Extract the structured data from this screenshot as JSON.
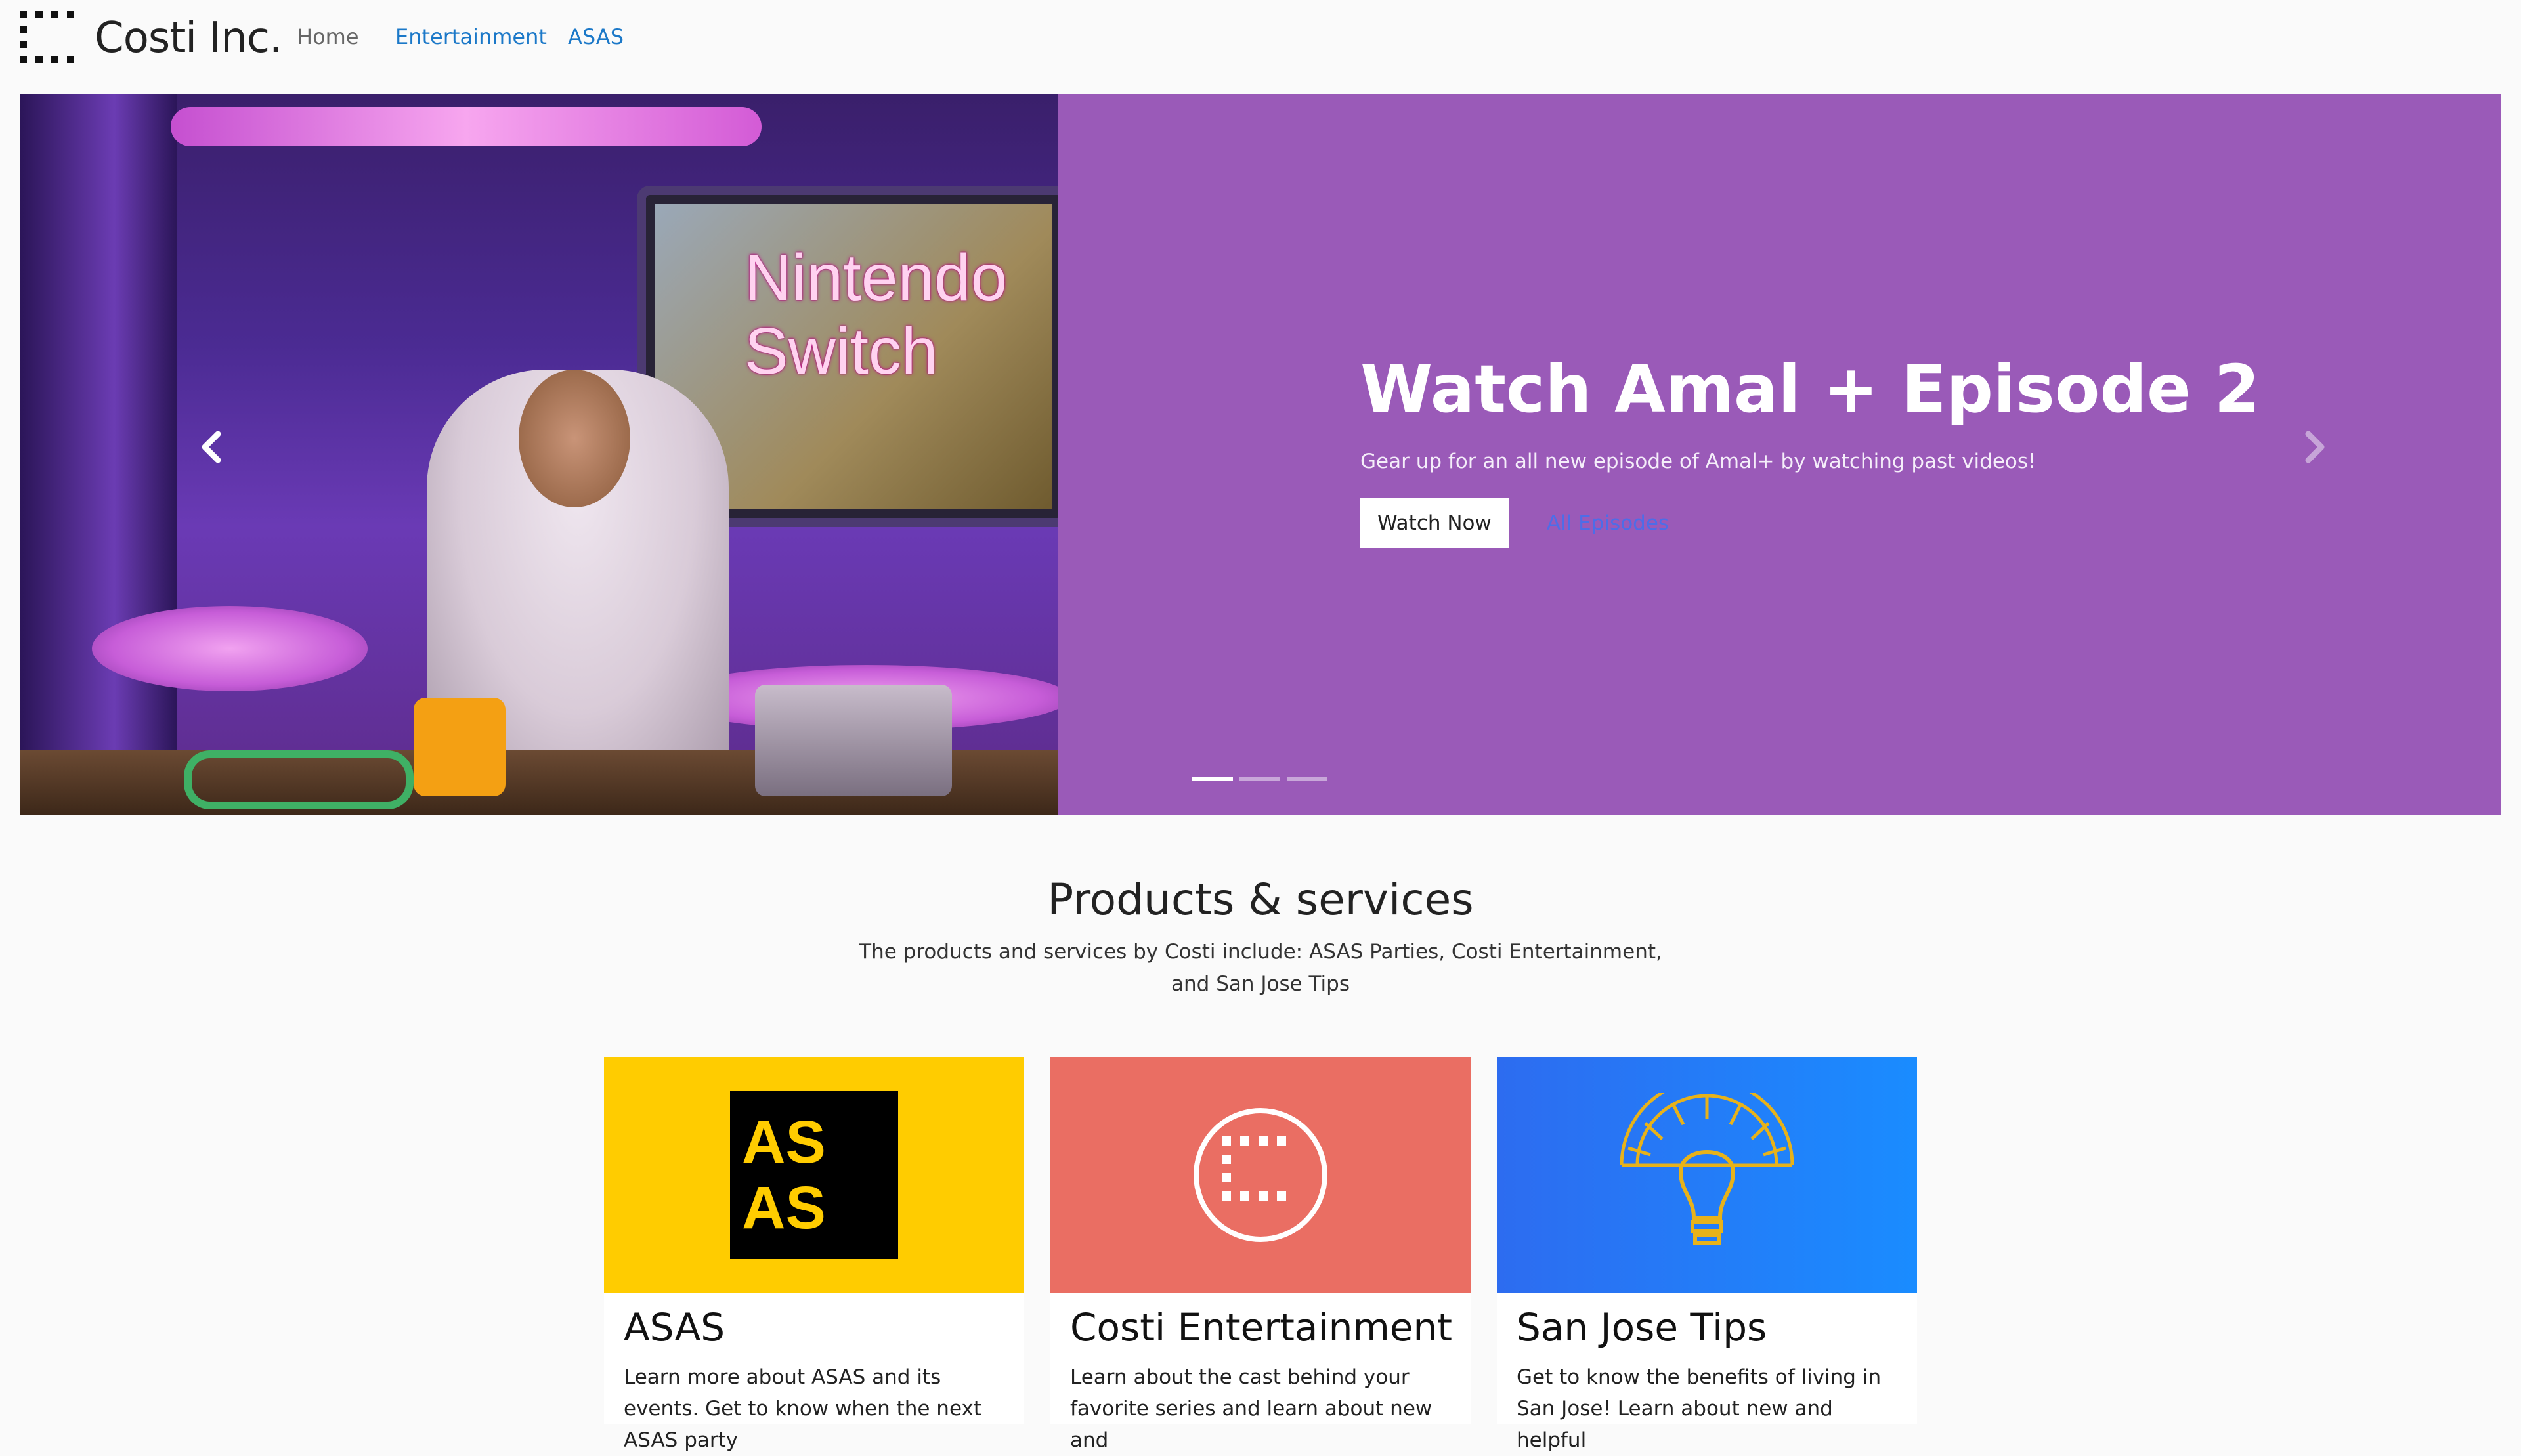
{
  "nav": {
    "brand": "Costi Inc.",
    "links": [
      "Home",
      "Entertainment",
      "ASAS"
    ]
  },
  "hero": {
    "image_text_line1": "Nintendo",
    "image_text_line2": "Switch",
    "title": "Watch Amal + Episode 2",
    "subtitle": "Gear up for an all new episode of Amal+ by watching past videos!",
    "primary_button": "Watch Now",
    "secondary_link": "All Episodes",
    "prev_icon": "chevron-left-icon",
    "next_icon": "chevron-right-icon",
    "slide_count": 3,
    "active_slide": 1,
    "background_color": "#9a5ab8"
  },
  "products": {
    "title": "Products & services",
    "description": "The products and services by Costi include: ASAS Parties, Costi Entertainment, and San Jose Tips",
    "cards": [
      {
        "title": "ASAS",
        "text": "Learn more about ASAS and its events. Get to know when the next ASAS party",
        "logo_line1": "AS",
        "logo_line2": "AS",
        "color": "#ffcc00"
      },
      {
        "title": "Costi Entertainment",
        "text": "Learn about the cast behind your favorite series and learn about new and",
        "icon": "film-frame-icon",
        "color": "#ea6e63"
      },
      {
        "title": "San Jose Tips",
        "text": "Get to know the benefits of living in San Jose! Learn about new and helpful",
        "icon": "lightbulb-sun-icon",
        "color": "#1a8cff"
      }
    ]
  }
}
